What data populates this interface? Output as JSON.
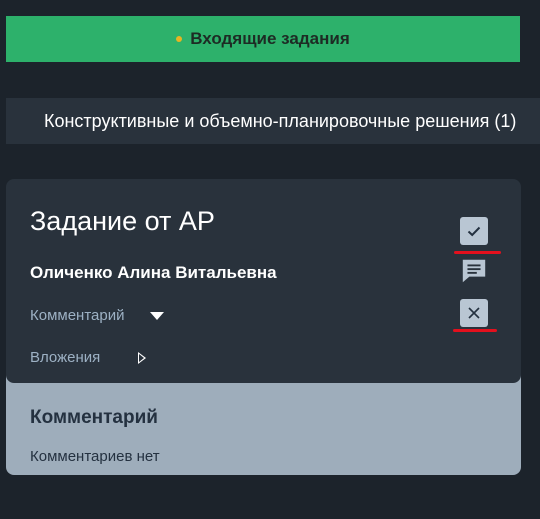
{
  "incoming_tab": {
    "label": "Входящие задания",
    "accent_color": "#2db16b",
    "dot_color": "#e8b422"
  },
  "section": {
    "label": "Конструктивные и объемно-планировочные решения (1)"
  },
  "task_card": {
    "title": "Задание от АР",
    "author": "Оличенко Алина Витальевна",
    "comment_toggle_label": "Комментарий",
    "attachments_toggle_label": "Вложения",
    "actions": [
      {
        "icon": "check-icon",
        "name": "approve"
      },
      {
        "icon": "comment-icon",
        "name": "comment"
      },
      {
        "icon": "close-icon",
        "name": "reject"
      }
    ]
  },
  "comment_panel": {
    "title": "Комментарий",
    "empty_text": "Комментариев нет"
  },
  "colors": {
    "background": "#1c232b",
    "card": "#29323c",
    "panel": "#9eadbb",
    "annotation_red": "#e3101d"
  }
}
